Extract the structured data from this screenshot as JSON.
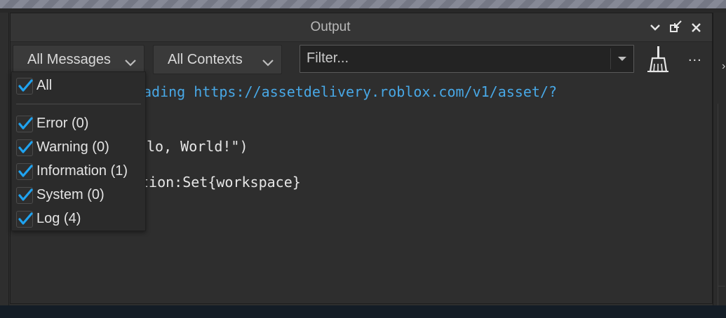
{
  "window": {
    "title": "Output"
  },
  "toolbar": {
    "messages_filter": "All Messages",
    "contexts_filter": "All Contexts",
    "filter_placeholder": "Filter...",
    "more": "..."
  },
  "console": {
    "lines": [
      {
        "text": "ading https://assetdelivery.roblox.com/v1/asset/?",
        "kind": "info"
      },
      {
        "text": "lo, World!\")",
        "kind": "log"
      },
      {
        "text": "tion:Set{workspace}",
        "kind": "log"
      }
    ]
  },
  "menu": {
    "all": {
      "label": "All",
      "checked": true
    },
    "items": [
      {
        "label": "Error (0)",
        "checked": true
      },
      {
        "label": "Warning (0)",
        "checked": true
      },
      {
        "label": "Information (1)",
        "checked": true
      },
      {
        "label": "System (0)",
        "checked": true
      },
      {
        "label": "Log (4)",
        "checked": true
      }
    ]
  },
  "colors": {
    "accent_check": "#1fa3f0",
    "info_text": "#48a8e6",
    "panel_bg": "#2e2e2e"
  },
  "icons": {
    "titlebar": [
      "chevron-down-icon",
      "undock-icon",
      "close-icon"
    ],
    "clear": "broom-icon"
  }
}
